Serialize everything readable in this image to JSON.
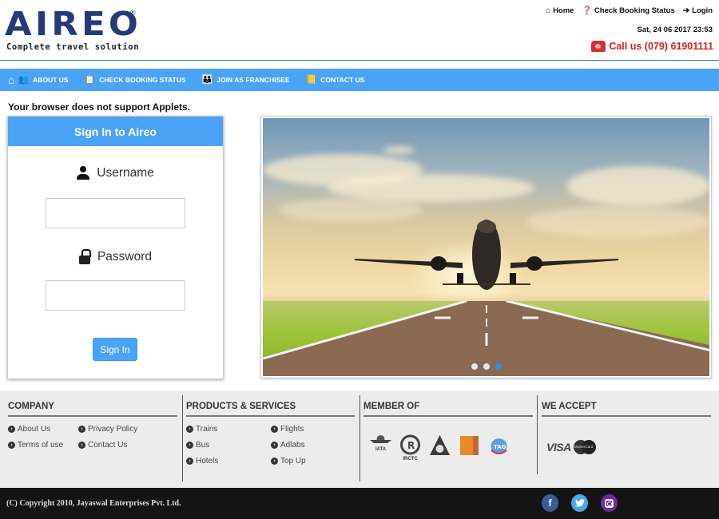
{
  "header": {
    "logo_text": "AIREO",
    "logo_registered": "®",
    "tagline": "Complete travel solution",
    "top_links": [
      {
        "label": "Home",
        "icon": "home-icon"
      },
      {
        "label": "Check Booking Status",
        "icon": "question-circle-icon"
      },
      {
        "label": "Login",
        "icon": "sign-in-icon"
      }
    ],
    "datetime": "Sat, 24 06 2017 23:53",
    "call_label": "Call us (079) 61901111",
    "call_color": "#e02020",
    "brand_color": "#243a7a"
  },
  "nav": {
    "accent": "#4aa3f5",
    "items": [
      {
        "label": "ABOUT US",
        "icon": "people-icon"
      },
      {
        "label": "CHECK BOOKING STATUS",
        "icon": "clipboard-icon"
      },
      {
        "label": "JOIN AS FRANCHISEE",
        "icon": "group-icon"
      },
      {
        "label": "CONTACT US",
        "icon": "contact-book-icon"
      }
    ]
  },
  "applet_message": "Your browser does not support Applets.",
  "signin": {
    "title": "Sign In to Aireo",
    "username_label": "Username",
    "username_value": "",
    "password_label": "Password",
    "password_value": "",
    "button_label": "Sign In"
  },
  "carousel": {
    "image_description": "airplane taking off from runway at sunset",
    "slide_count": 3,
    "active_slide": 3
  },
  "footer": {
    "company": {
      "title": "COMPANY",
      "links": [
        "About Us",
        "Privacy Policy",
        "Terms of use",
        "Contact Us"
      ]
    },
    "products": {
      "title": "PRODUCTS & SERVICES",
      "links": [
        "Trains",
        "Flights",
        "Bus",
        "Adlabs",
        "Hotels",
        "Top Up"
      ]
    },
    "member": {
      "title": "MEMBER OF",
      "logos": [
        "IATA",
        "IRCTC",
        "TAAI",
        "Gujarat",
        "TAG"
      ]
    },
    "accept": {
      "title": "WE ACCEPT",
      "cards": [
        "VISA",
        "MasterCard"
      ]
    }
  },
  "bottom": {
    "copyright": "(C) Copyright 2010, Jayaswal Enterprises Pvt. Ltd.",
    "social": [
      {
        "name": "facebook",
        "glyph": "f",
        "color": "#3b5b98"
      },
      {
        "name": "twitter",
        "glyph": "t",
        "color": "#4aa8ea"
      },
      {
        "name": "instagram",
        "glyph": "",
        "color": "#6f2aa0"
      }
    ]
  }
}
